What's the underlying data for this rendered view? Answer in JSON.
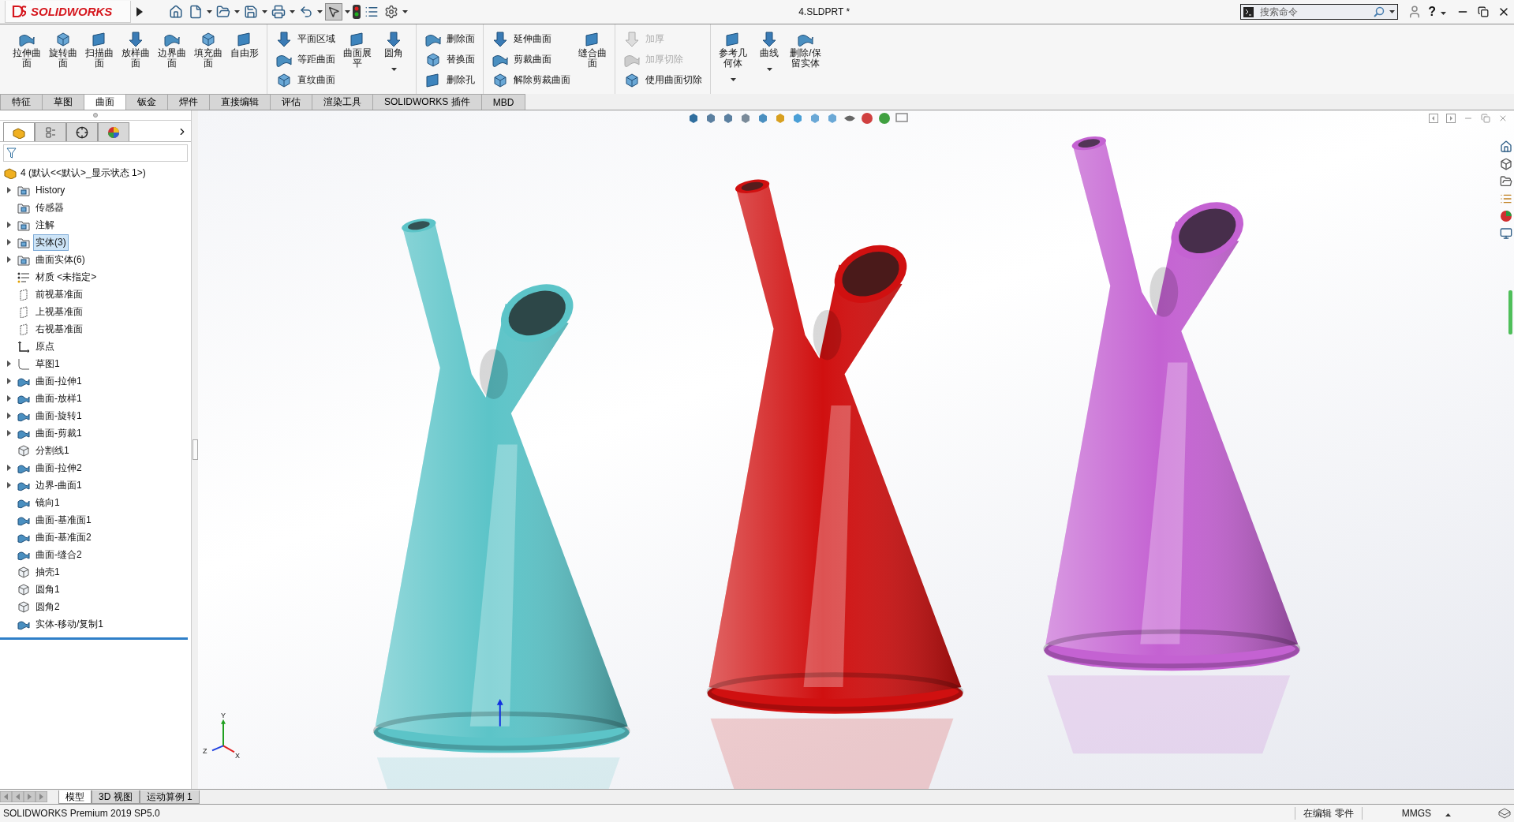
{
  "titlebar": {
    "logo": "SOLIDWORKS",
    "title": "4.SLDPRT *",
    "search_placeholder": "搜索命令",
    "help": "?"
  },
  "ribbon": {
    "groups": [
      {
        "items": [
          {
            "kind": "large",
            "label": "拉伸曲面",
            "dropdown": false
          },
          {
            "kind": "large",
            "label": "旋转曲面",
            "dropdown": false
          },
          {
            "kind": "large",
            "label": "扫描曲面",
            "dropdown": false
          },
          {
            "kind": "large",
            "label": "放样曲面",
            "dropdown": false
          },
          {
            "kind": "large",
            "label": "边界曲面",
            "dropdown": false
          },
          {
            "kind": "large",
            "label": "填充曲面",
            "dropdown": false
          },
          {
            "kind": "large",
            "label": "自由形",
            "dropdown": false
          }
        ]
      },
      {
        "items": [
          {
            "kind": "stack",
            "buttons": [
              {
                "label": "平面区域",
                "disabled": false
              },
              {
                "label": "等距曲面",
                "disabled": false
              },
              {
                "label": "直纹曲面",
                "disabled": false
              }
            ]
          },
          {
            "kind": "large",
            "label": "曲面展平",
            "dropdown": false
          },
          {
            "kind": "large",
            "label": "圆角",
            "dropdown": true
          }
        ]
      },
      {
        "items": [
          {
            "kind": "stack",
            "buttons": [
              {
                "label": "删除面",
                "disabled": false
              },
              {
                "label": "替换面",
                "disabled": false
              },
              {
                "label": "删除孔",
                "disabled": false
              }
            ]
          }
        ]
      },
      {
        "items": [
          {
            "kind": "stack",
            "buttons": [
              {
                "label": "延伸曲面",
                "disabled": false
              },
              {
                "label": "剪裁曲面",
                "disabled": false
              },
              {
                "label": "解除剪裁曲面",
                "disabled": false
              }
            ]
          },
          {
            "kind": "large",
            "label": "缝合曲面",
            "dropdown": false
          }
        ]
      },
      {
        "items": [
          {
            "kind": "stack",
            "buttons": [
              {
                "label": "加厚",
                "disabled": true
              },
              {
                "label": "加厚切除",
                "disabled": true
              },
              {
                "label": "使用曲面切除",
                "disabled": false
              }
            ]
          }
        ]
      },
      {
        "items": [
          {
            "kind": "large",
            "label": "参考几何体",
            "dropdown": true
          },
          {
            "kind": "large",
            "label": "曲线",
            "dropdown": true
          },
          {
            "kind": "large",
            "label": "删除/保留实体",
            "dropdown": false
          }
        ]
      }
    ]
  },
  "tabs": [
    {
      "label": "特征",
      "selected": false
    },
    {
      "label": "草图",
      "selected": false
    },
    {
      "label": "曲面",
      "selected": true
    },
    {
      "label": "钣金",
      "selected": false
    },
    {
      "label": "焊件",
      "selected": false
    },
    {
      "label": "直接编辑",
      "selected": false
    },
    {
      "label": "评估",
      "selected": false
    },
    {
      "label": "渲染工具",
      "selected": false
    },
    {
      "label": "SOLIDWORKS 插件",
      "selected": false
    },
    {
      "label": "MBD",
      "selected": false
    }
  ],
  "panel_tabs": [
    {
      "selected": true
    },
    {
      "selected": false
    },
    {
      "selected": false
    },
    {
      "selected": false
    }
  ],
  "tree": {
    "root": "4  (默认<<默认>_显示状态 1>)",
    "items": [
      {
        "label": "History",
        "kind": "folder",
        "expandable": true,
        "selected": false
      },
      {
        "label": "传感器",
        "kind": "folder",
        "expandable": false,
        "selected": false
      },
      {
        "label": "注解",
        "kind": "folder",
        "expandable": true,
        "selected": false
      },
      {
        "label": "实体(3)",
        "kind": "folder",
        "expandable": true,
        "selected": true
      },
      {
        "label": "曲面实体(6)",
        "kind": "folder",
        "expandable": true,
        "selected": false
      },
      {
        "label": "材质 <未指定>",
        "kind": "material",
        "expandable": false,
        "selected": false
      },
      {
        "label": "前视基准面",
        "kind": "plane",
        "expandable": false,
        "selected": false
      },
      {
        "label": "上视基准面",
        "kind": "plane",
        "expandable": false,
        "selected": false
      },
      {
        "label": "右视基准面",
        "kind": "plane",
        "expandable": false,
        "selected": false
      },
      {
        "label": "原点",
        "kind": "origin",
        "expandable": false,
        "selected": false
      },
      {
        "label": "草图1",
        "kind": "sketch",
        "expandable": true,
        "selected": false
      },
      {
        "label": "曲面-拉伸1",
        "kind": "feature",
        "expandable": true,
        "selected": false
      },
      {
        "label": "曲面-放样1",
        "kind": "feature",
        "expandable": true,
        "selected": false
      },
      {
        "label": "曲面-旋转1",
        "kind": "feature",
        "expandable": true,
        "selected": false
      },
      {
        "label": "曲面-剪裁1",
        "kind": "feature",
        "expandable": true,
        "selected": false
      },
      {
        "label": "分割线1",
        "kind": "solid",
        "expandable": false,
        "selected": false
      },
      {
        "label": "曲面-拉伸2",
        "kind": "feature",
        "expandable": true,
        "selected": false
      },
      {
        "label": "边界-曲面1",
        "kind": "feature",
        "expandable": true,
        "selected": false
      },
      {
        "label": "镜向1",
        "kind": "feature",
        "expandable": false,
        "selected": false
      },
      {
        "label": "曲面-基准面1",
        "kind": "feature",
        "expandable": false,
        "selected": false
      },
      {
        "label": "曲面-基准面2",
        "kind": "feature",
        "expandable": false,
        "selected": false
      },
      {
        "label": "曲面-缝合2",
        "kind": "feature",
        "expandable": false,
        "selected": false
      },
      {
        "label": "抽壳1",
        "kind": "solid",
        "expandable": false,
        "selected": false
      },
      {
        "label": "圆角1",
        "kind": "solid",
        "expandable": false,
        "selected": false
      },
      {
        "label": "圆角2",
        "kind": "solid",
        "expandable": false,
        "selected": false
      },
      {
        "label": "实体-移动/复制1",
        "kind": "feature",
        "expandable": false,
        "selected": false
      }
    ]
  },
  "viewport": {
    "bodies": [
      {
        "color": "#5cc4c8"
      },
      {
        "color": "#d01010"
      },
      {
        "color": "#c462d2"
      }
    ],
    "triad": {
      "x": "X",
      "y": "Y",
      "z": "Z"
    }
  },
  "bottom_tabs": [
    {
      "label": "模型",
      "selected": true
    },
    {
      "label": "3D 视图",
      "selected": false
    },
    {
      "label": "运动算例 1",
      "selected": false
    }
  ],
  "status": {
    "version": "SOLIDWORKS Premium 2019 SP5.0",
    "mode": "在编辑 零件",
    "units": "MMGS"
  }
}
